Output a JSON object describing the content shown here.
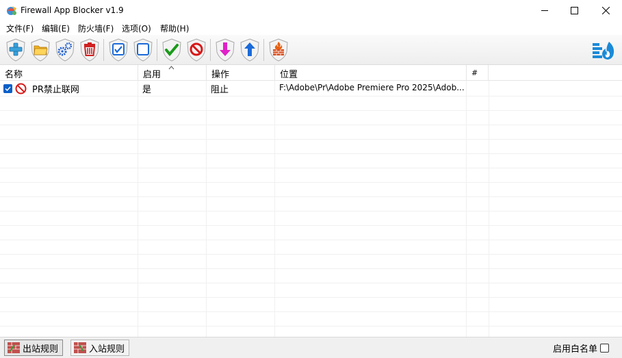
{
  "window": {
    "title": "Firewall App Blocker v1.9"
  },
  "menu": [
    "文件(F)",
    "编辑(E)",
    "防火墙(F)",
    "选项(O)",
    "帮助(H)"
  ],
  "toolbar": {
    "buttons": [
      "add-icon",
      "open-folder-icon",
      "settings-gears-icon",
      "delete-icon",
      "check-all-icon",
      "uncheck-all-icon",
      "allow-icon",
      "block-icon",
      "move-down-icon",
      "move-up-icon",
      "firewall-icon"
    ],
    "colors": {
      "add": "#3aa0d8",
      "folder": "#f0b020",
      "gears": "#1f5fd0",
      "delete": "#d02020",
      "check": "#1a9a1a",
      "block": "#d81818",
      "down": "#e020c8",
      "up": "#1a6ad8",
      "fire": "#e86010"
    }
  },
  "columns": [
    "名称",
    "启用",
    "操作",
    "位置",
    "#"
  ],
  "rows": [
    {
      "checked": true,
      "name": "PR禁止联网",
      "enabled": "是",
      "action": "阻止",
      "location": "F:\\Adobe\\Pr\\Adobe Premiere Pro 2025\\Adob..."
    }
  ],
  "tabs": [
    "出站规则",
    "入站规则"
  ],
  "whitelist_label": "启用白名单",
  "whitelist_checked": false
}
